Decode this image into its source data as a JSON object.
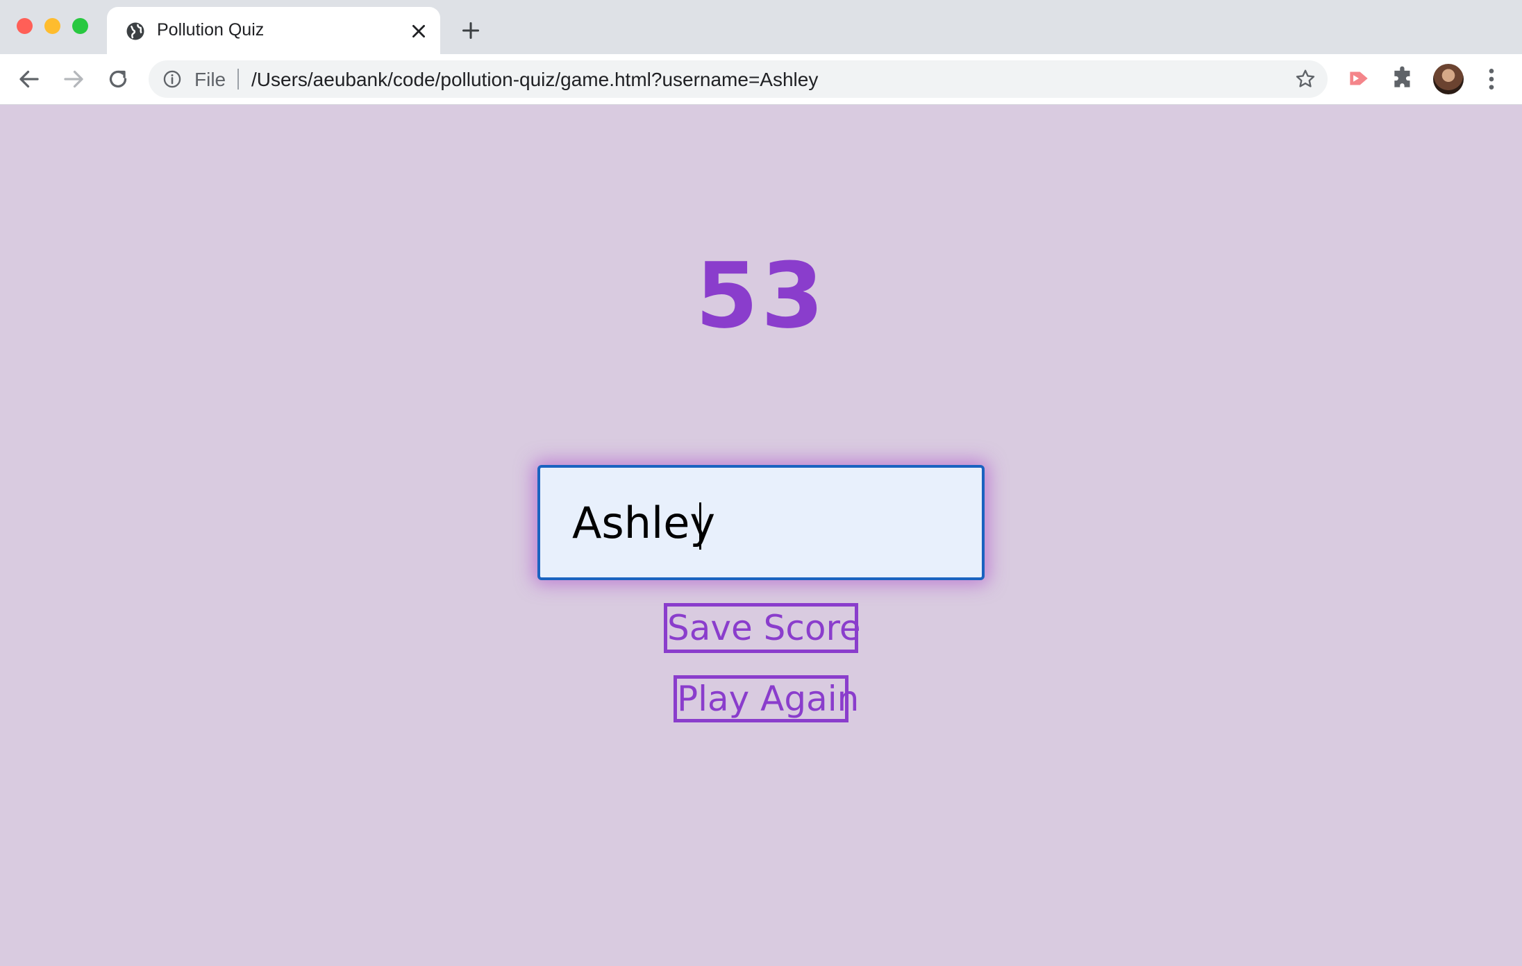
{
  "window": {
    "traffic_lights": [
      "close",
      "minimize",
      "maximize"
    ]
  },
  "tab": {
    "title": "Pollution Quiz",
    "favicon": "globe-icon"
  },
  "toolbar": {
    "scheme_label": "File",
    "url": "/Users/aeubank/code/pollution-quiz/game.html?username=Ashley"
  },
  "page": {
    "score": "53",
    "username_value": "Ashley",
    "save_button": "Save Score",
    "play_again_button": "Play Again",
    "colors": {
      "background": "#d9cbe0",
      "accent": "#8a3dcc",
      "input_border": "#1a63c0",
      "input_background": "#e8f0fc"
    }
  }
}
